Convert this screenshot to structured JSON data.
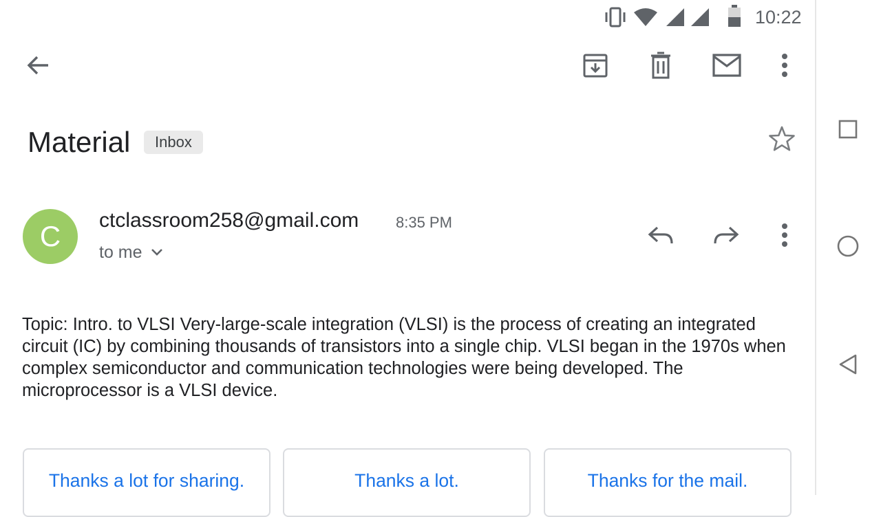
{
  "status_bar": {
    "time": "10:22"
  },
  "toolbar": {
    "back_icon": "arrow-back-icon",
    "archive_icon": "archive-icon",
    "delete_icon": "delete-icon",
    "mark_unread_icon": "mail-icon",
    "more_icon": "more-vert-icon"
  },
  "email": {
    "subject": "Material",
    "label": "Inbox",
    "avatar_letter": "C",
    "avatar_color": "#9ccc65",
    "sender": "ctclassroom258@gmail.com",
    "time": "8:35 PM",
    "recipient": "to me",
    "body": "Topic: Intro. to VLSI Very-large-scale integration (VLSI) is the process of creating an integrated circuit (IC) by combining thousands of transistors into a single chip. VLSI began in the 1970s when complex semiconductor and communication technologies were being developed. The microprocessor is a VLSI device."
  },
  "smart_replies": [
    {
      "label": "Thanks a lot for sharing."
    },
    {
      "label": "Thanks a lot."
    },
    {
      "label": "Thanks for the mail."
    }
  ],
  "colors": {
    "accent": "#1a73e8",
    "icon": "#5f6368"
  }
}
